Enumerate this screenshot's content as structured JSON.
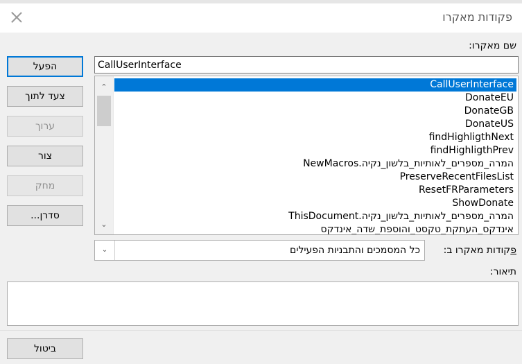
{
  "window": {
    "title": "פקודות מאקרו"
  },
  "labels": {
    "macro_name": "שם מאקרו:",
    "macros_in": "פקודות מאקרו ב:",
    "description": "תיאור:"
  },
  "macro_name_value": "CallUserInterface",
  "macro_list": [
    "CallUserInterface",
    "DonateEU",
    "DonateGB",
    "DonateUS",
    "findHighligthNext",
    "findHighligthPrev",
    "NewMacros.המרה_מספרים_לאותיות_בלשון_נקיה",
    "PreserveRecentFilesList",
    "ResetFRParameters",
    "ShowDonate",
    "ThisDocument.המרה_מספרים_לאותיות_בלשון_נקיה",
    "אינדקס_העתקת_טקסט_והוספת_שדה_אינדקס"
  ],
  "selected_index": 0,
  "macros_in_value": "כל המסמכים והתבניות הפעילים",
  "description_value": "",
  "buttons": {
    "run": "הפעל",
    "step_into": "צעד לתוך",
    "edit": "ערוך",
    "create": "צור",
    "delete": "מחק",
    "organizer": "סדרן...",
    "cancel": "ביטול"
  },
  "icons": {
    "close": "close-icon",
    "scroll_up": "chevron-up-icon",
    "scroll_down": "chevron-down-icon",
    "dropdown": "chevron-down-icon"
  },
  "colors": {
    "selection": "#0078d7",
    "default_button_border": "#0078d7"
  }
}
